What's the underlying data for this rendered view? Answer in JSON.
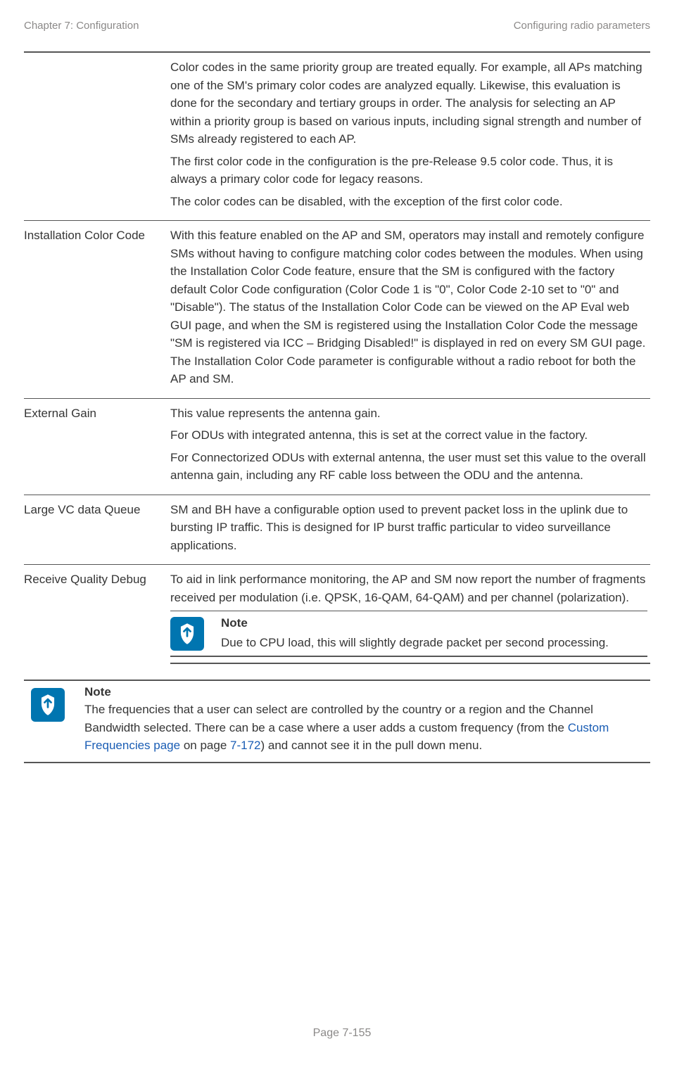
{
  "header": {
    "left": "Chapter 7:  Configuration",
    "right": "Configuring radio parameters"
  },
  "rows": {
    "r0": {
      "p1": "Color codes in the same priority group are treated equally. For example, all APs matching one of the SM's primary color codes are analyzed equally. Likewise, this evaluation is done for the secondary and tertiary groups in order. The analysis for selecting an AP within a priority group is based on various inputs, including signal strength and number of SMs already registered to each AP.",
      "p2": "The first color code in the configuration is the pre-Release 9.5 color code. Thus, it is always a primary color code for legacy reasons.",
      "p3": "The color codes can be disabled, with the exception of the first color code."
    },
    "r1": {
      "label": "Installation Color Code",
      "p1": "With this feature enabled on the AP and SM, operators may install and remotely configure SMs without having to configure matching color codes between the modules. When using the Installation Color Code feature, ensure that the SM is configured with the factory default Color Code configuration (Color Code 1 is \"0\", Color Code 2-10 set to \"0\" and \"Disable\"). The status of the Installation Color Code can be viewed on the AP Eval web GUI page, and when the SM is registered using the Installation Color Code the message \"SM is registered via ICC – Bridging Disabled!\" is displayed in red on every SM GUI page. The Installation Color Code parameter is configurable without a radio reboot for both the AP and SM."
    },
    "r2": {
      "label": "External Gain",
      "p1": "This value represents the antenna gain.",
      "p2": "For ODUs with integrated antenna, this is set at the correct value in the factory.",
      "p3": "For Connectorized ODUs with external antenna, the user must set this value to the overall antenna gain, including any RF cable loss between the ODU and the antenna."
    },
    "r3": {
      "label": "Large VC data Queue",
      "p1": "SM and BH have a configurable option used to prevent packet loss in the uplink due to bursting IP traffic. This is designed for IP burst traffic particular to video surveillance applications."
    },
    "r4": {
      "label": "Receive Quality Debug",
      "p1": "To aid in link performance monitoring, the AP and SM now report the number of fragments received per modulation (i.e. QPSK, 16-QAM, 64-QAM) and per channel (polarization).",
      "note_title": "Note",
      "note_text": "Due to CPU load, this will slightly degrade packet per second processing."
    }
  },
  "standalone_note": {
    "title": "Note",
    "pre": "The frequencies that a user can select are controlled by the country or a region and the Channel Bandwidth selected. There can be a case where a user adds a custom frequency (from the ",
    "link1": "Custom Frequencies page",
    "mid": " on page ",
    "link2": "7-172",
    "post": ") and cannot see it in the pull down menu."
  },
  "footer": "Page 7-155"
}
